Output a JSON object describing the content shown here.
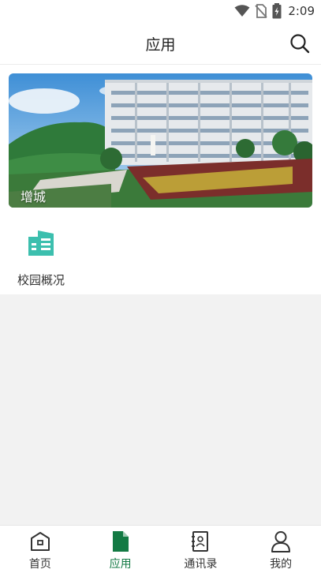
{
  "status": {
    "time": "2:09",
    "icons": [
      "wifi-icon",
      "no-sim-icon",
      "battery-charging-icon"
    ]
  },
  "header": {
    "title": "应用",
    "search_icon": "search-icon"
  },
  "banner": {
    "caption": "增城"
  },
  "apps": [
    {
      "label": "校园概况",
      "icon": "buildings-icon",
      "color": "#3cbfae"
    }
  ],
  "tabbar": {
    "active_color": "#137a44",
    "items": [
      {
        "label": "首页",
        "icon": "home-icon"
      },
      {
        "label": "应用",
        "icon": "document-icon"
      },
      {
        "label": "通讯录",
        "icon": "contacts-icon"
      },
      {
        "label": "我的",
        "icon": "person-icon"
      }
    ]
  }
}
